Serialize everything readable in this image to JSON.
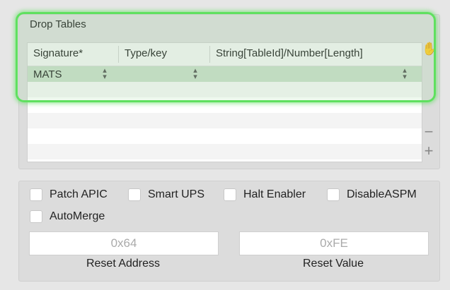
{
  "drop_tables": {
    "title": "Drop Tables",
    "columns": [
      "Signature*",
      "Type/key",
      "String[TableId]/Number[Length]"
    ],
    "rows": [
      {
        "signature": "MATS",
        "type_key": "",
        "string_number": ""
      }
    ]
  },
  "options": {
    "patch_apic": "Patch APIC",
    "smart_ups": "Smart UPS",
    "halt_enabler": "Halt Enabler",
    "disable_aspm": "DisableASPM",
    "auto_merge": "AutoMerge"
  },
  "reset_address": {
    "label": "Reset Address",
    "placeholder": "0x64"
  },
  "reset_value": {
    "label": "Reset Value",
    "placeholder": "0xFE"
  },
  "icons": {
    "hand": "hand-drag-icon",
    "remove": "minus-icon",
    "add": "plus-icon",
    "stepper": "up-down-stepper-icon"
  },
  "colors": {
    "highlight": "#5fe05f",
    "selected_row": "#c9dcc9"
  }
}
